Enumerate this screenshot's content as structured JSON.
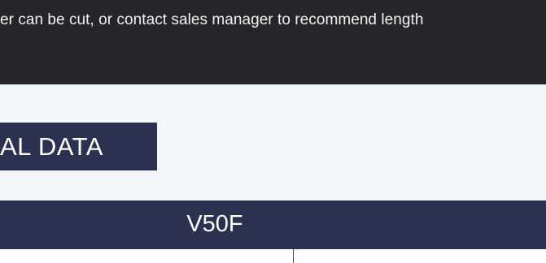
{
  "banner": {
    "text": "er can be cut, or contact sales manager to recommend length"
  },
  "section": {
    "title": "AL DATA"
  },
  "table": {
    "model": "V50F",
    "column_left": "",
    "column_right": ""
  },
  "colors": {
    "banner_background": "#25252a",
    "accent_navy": "#2c3150",
    "page_background": "#f4f6fa",
    "text_light": "#ffffff"
  }
}
